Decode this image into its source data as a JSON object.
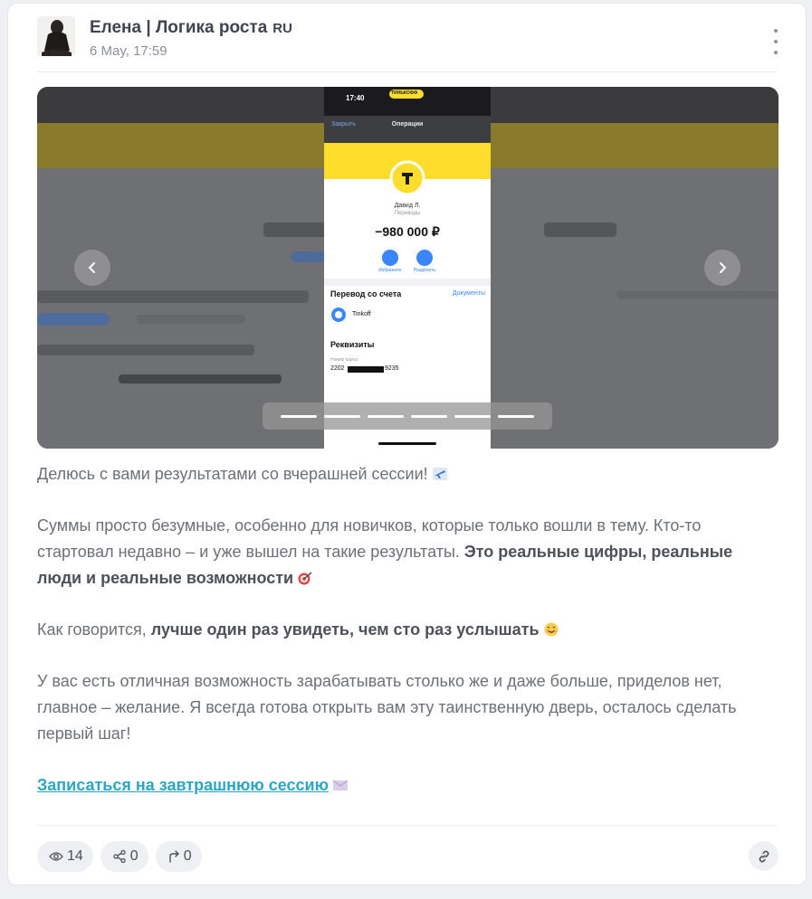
{
  "channel": {
    "name": "Елена | Логика роста",
    "lang_badge": "RU",
    "date": "6 May, 17:59"
  },
  "gallery": {
    "phone": {
      "status_time": "17:40",
      "bank_badge": "ТИНЬКОФФ",
      "close_label": "Закрыть",
      "screen_title": "Операции",
      "recipient": "Давид Л.",
      "category": "Переводы",
      "amount": "−980 000 ₽",
      "action_1": "Избранное",
      "action_2": "Разделить",
      "transfer_from": "Перевод со счета",
      "documents": "Документы",
      "account": "Tinkoff",
      "details_title": "Реквизиты",
      "card_number_label": "Номер карты",
      "card_start": "2202",
      "card_end": "9235"
    },
    "slide_count": 6
  },
  "post": {
    "p1": "Делюсь с вами результатами со вчерашней сессии!",
    "p2_plain": "Суммы просто безумные, особенно для новичков, которые только вошли в тему. Кто-то стартовал недавно – и уже вышел на такие результаты.",
    "p2_bold": "Это реальные цифры, реальные люди и реальные возможности",
    "p3_plain": "Как говорится,",
    "p3_bold": "лучше один раз увидеть, чем сто раз услышать",
    "p4": "У вас есть отличная возможность зарабатывать столько же и даже больше, приделов нет, главное – желание. Я всегда готова открыть вам эту таинственную дверь, осталось сделать первый шаг!",
    "cta": "Записаться на завтрашнюю сессию"
  },
  "stats": {
    "views": "14",
    "shares": "0",
    "forwards": "0"
  },
  "icons": {
    "views": "eye-icon",
    "shares": "share-icon",
    "forwards": "forward-icon",
    "link": "link-icon",
    "more": "more-vertical-icon"
  },
  "colors": {
    "accent": "#2ba6c4",
    "bank_yellow": "#ffdd2d",
    "muted": "#8a9099"
  }
}
